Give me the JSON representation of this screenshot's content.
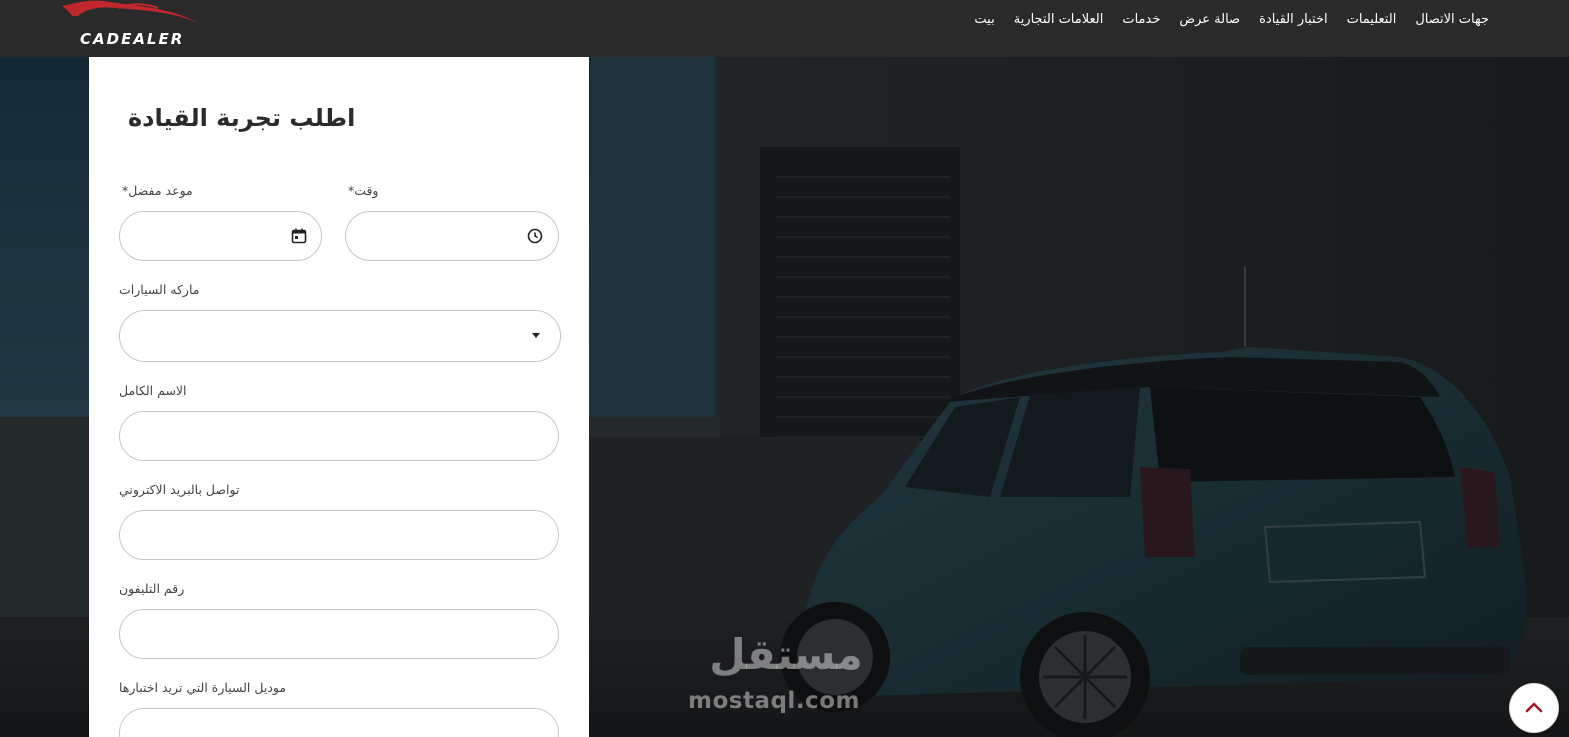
{
  "brand": {
    "name": "CADEALER",
    "accent": "#c0282e"
  },
  "nav": {
    "items": [
      {
        "label": "بيت"
      },
      {
        "label": "العلامات التجارية"
      },
      {
        "label": "خدمات"
      },
      {
        "label": "صالة عرض"
      },
      {
        "label": "اختبار القيادة"
      },
      {
        "label": "التعليمات"
      },
      {
        "label": "جهات الاتصال"
      }
    ]
  },
  "form": {
    "title": "اطلب تجربة القيادة",
    "preferred_date_label": "موعد مفضل",
    "time_label": "وقت",
    "required_mark": "*",
    "car_brand_label": "ماركه السيارات",
    "full_name_label": "الاسم الكامل",
    "email_label": "تواصل بالبريد الاكتروني",
    "phone_label": "رقم التليفون",
    "model_label": "موديل السيارة التي تريد اختبارها",
    "preferred_date_value": "",
    "time_value": "",
    "car_brand_value": "",
    "full_name_value": "",
    "email_value": "",
    "phone_value": "",
    "model_value": ""
  },
  "icons": {
    "date": "calendar-icon",
    "time": "clock-icon",
    "select": "caret-down-icon",
    "scroll": "chevron-up-icon"
  },
  "watermark": {
    "arabic": "مستقل",
    "latin": "mostaql.com"
  }
}
